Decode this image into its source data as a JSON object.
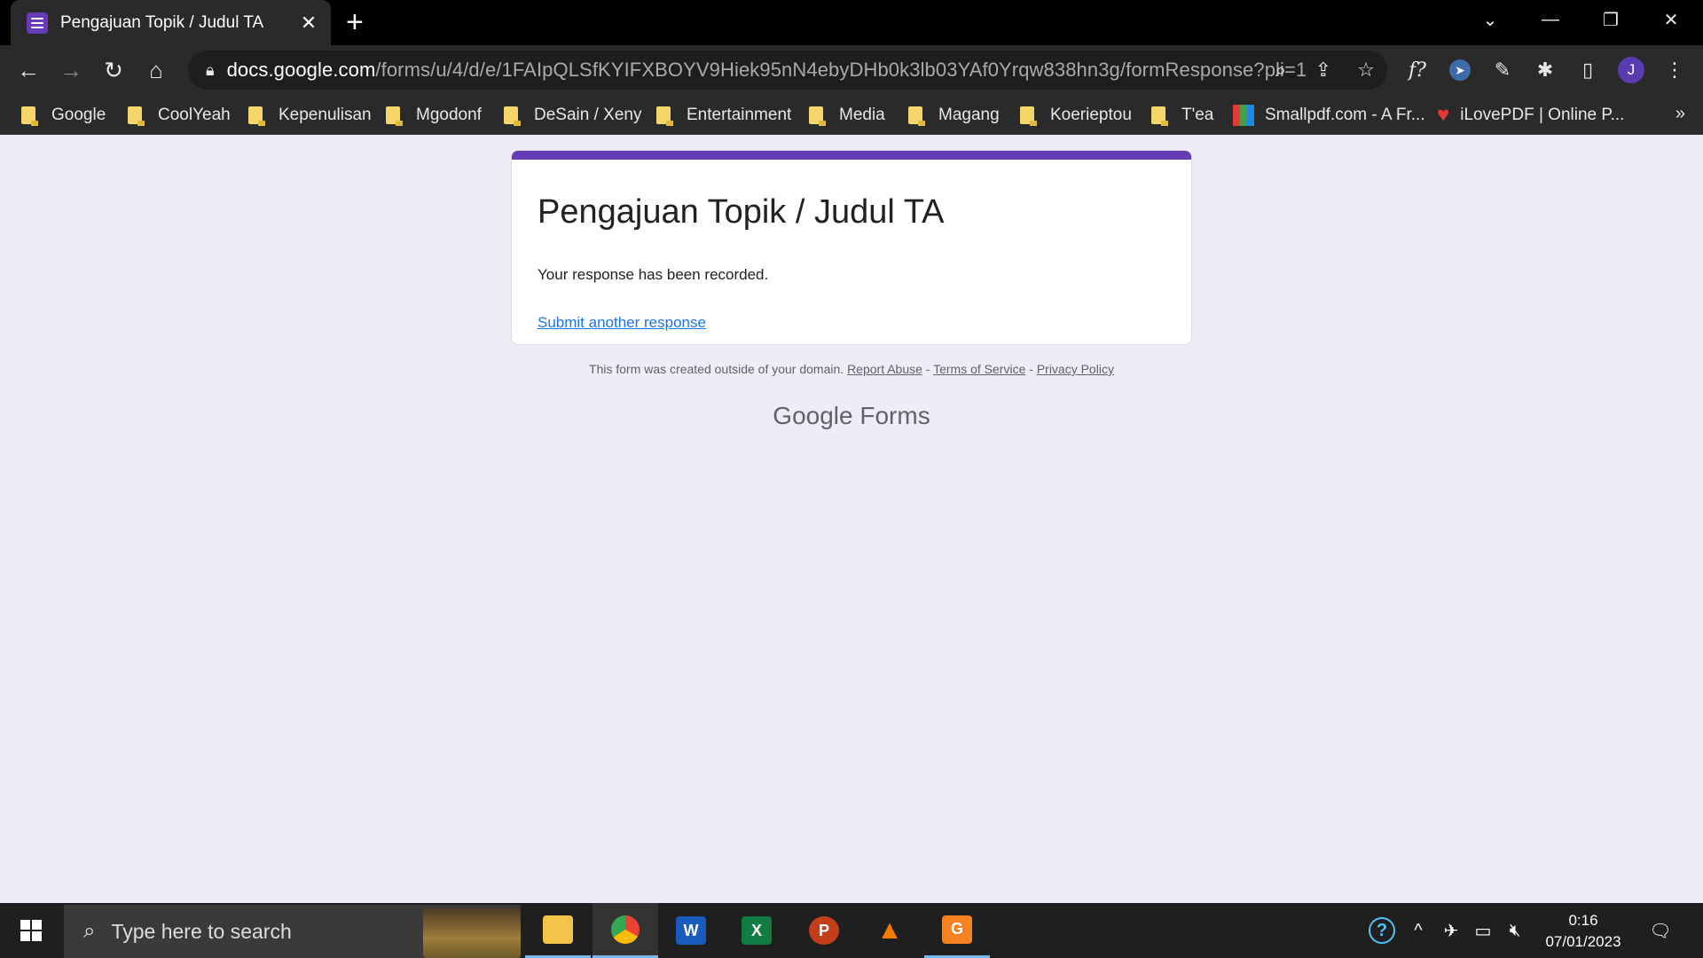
{
  "browser": {
    "tab_title": "Pengajuan Topik / Judul TA",
    "url_host": "docs.google.com",
    "url_path": "/forms/u/4/d/e/1FAIpQLSfKYIFXBOYV9Hiek95nN4ebyDHb0k3lb03YAf0Yrqw838hn3g/formResponse?pli=1",
    "profile_initial": "J",
    "ext_formula_label": "f?"
  },
  "bookmarks": [
    {
      "label": "Google",
      "icon": "folder-icon"
    },
    {
      "label": "CoolYeah",
      "icon": "folder-icon"
    },
    {
      "label": "Kepenulisan",
      "icon": "folder-icon"
    },
    {
      "label": "Mgodonf",
      "icon": "folder-icon"
    },
    {
      "label": "DeSain / Xeny",
      "icon": "folder-icon"
    },
    {
      "label": "Entertainment",
      "icon": "folder-icon"
    },
    {
      "label": "Media",
      "icon": "folder-icon"
    },
    {
      "label": "Magang",
      "icon": "folder-icon"
    },
    {
      "label": "Koerieptou",
      "icon": "folder-icon"
    },
    {
      "label": "T'ea",
      "icon": "folder-icon"
    },
    {
      "label": "Smallpdf.com - A Fr...",
      "icon": "smallpdf-icon"
    },
    {
      "label": "iLovePDF | Online P...",
      "icon": "ilovepdf-heart-icon"
    }
  ],
  "form": {
    "title": "Pengajuan Topik / Judul TA",
    "confirmation": "Your response has been recorded.",
    "another_link": "Submit another response",
    "accent_color": "#673ab7"
  },
  "footer": {
    "note": "This form was created outside of your domain.",
    "report_abuse": "Report Abuse",
    "sep": " - ",
    "terms": "Terms of Service",
    "privacy": "Privacy Policy",
    "brand_google": "Google",
    "brand_forms": "Forms"
  },
  "taskbar": {
    "search_placeholder": "Type here to search",
    "time": "0:16",
    "date": "07/01/2023",
    "apps": [
      "file-explorer-icon",
      "chrome-icon",
      "word-icon",
      "excel-icon",
      "powerpoint-icon",
      "vlc-icon",
      "pdf-app-icon"
    ]
  }
}
